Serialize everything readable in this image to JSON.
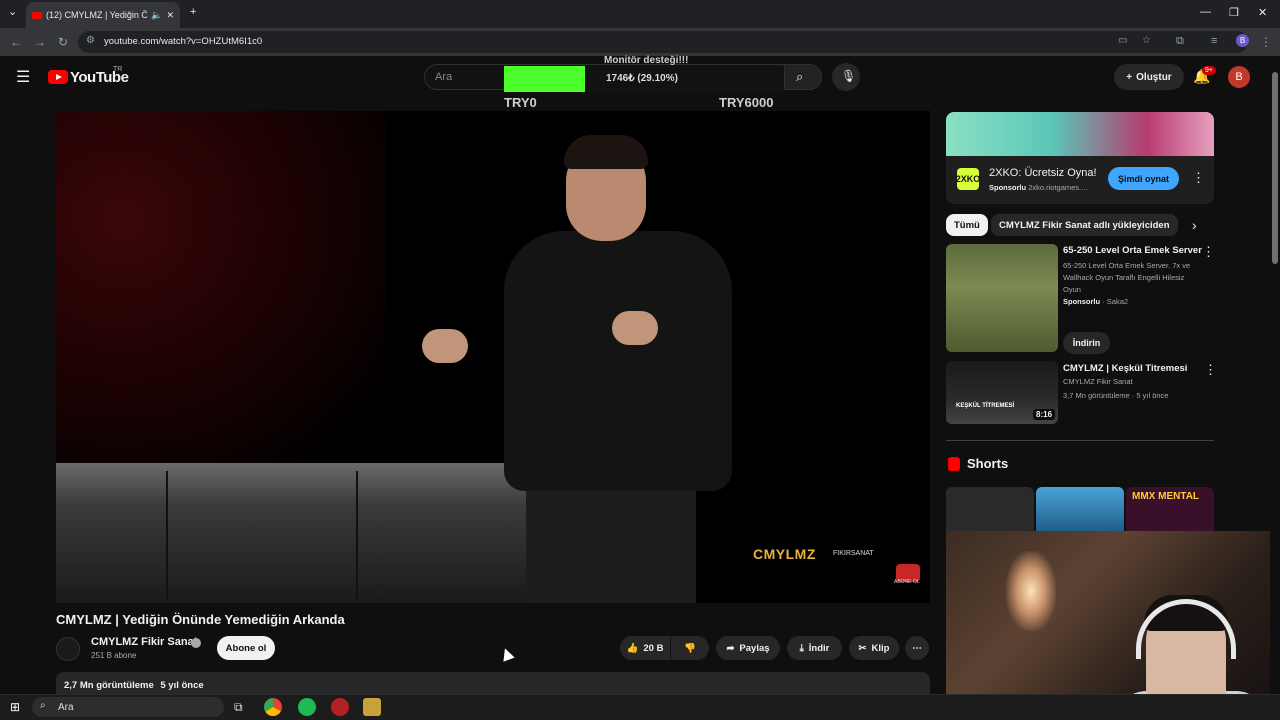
{
  "browser": {
    "tab_title": "(12) CMYLMZ | Yediğin Önü",
    "url": "youtube.com/watch?v=OHZUtM6I1c0"
  },
  "youtube": {
    "logo_text": "YouTube",
    "region": "TR",
    "search_placeholder": "Ara",
    "create_label": "Oluştur",
    "notification_count": "9+",
    "avatar_letter": "B"
  },
  "donation": {
    "title": "Monitör desteği!!!",
    "amount_text": "1746₺ (29.10%)",
    "progress_fraction": 0.291,
    "min_label": "TRY0",
    "max_label": "TRY6000"
  },
  "video": {
    "watermark": "CMYLMZ",
    "watermark_sub": "FIKIRSANAT",
    "subscribe_overlay": "ABONE OL",
    "title": "CMYLMZ | Yediğin Önünde Yemediğin Arkanda",
    "channel_name": "CMYLMZ Fikir Sanat",
    "subscribers": "251 B abone",
    "subscribe_label": "Abone ol",
    "like_count": "20 B",
    "share_label": "Paylaş",
    "download_label": "İndir",
    "clip_label": "Klip",
    "views": "2,7 Mn görüntüleme",
    "age": "5 yıl önce"
  },
  "sidebar": {
    "ad": {
      "logo": "2XKO",
      "title": "2XKO: Ücretsiz Oyna!",
      "sponsored": "Sponsorlu",
      "domain": "2xko.riotgames....",
      "cta": "Şimdi oynat"
    },
    "chips": [
      "Tümü",
      "CMYLMZ Fikir Sanat adlı yükleyiciden"
    ],
    "recs": [
      {
        "title": "65-250 Level Orta Emek Server",
        "desc": "65-250 Level Orta Emek Server. 7x ve Wallhack Oyun Taraflı Engelli Hilesiz Oyun",
        "sponsored": "Sponsorlu",
        "advertiser": "Saka2",
        "cta": "İndirin"
      },
      {
        "title": "CMYLMZ | Keşkül Titremesi",
        "channel": "CMYLMZ Fikir Sanat",
        "meta": "3,7 Mn görüntüleme · 5 yıl önce",
        "duration": "8:16",
        "thumb_caption": "KEŞKÜL TİTREMESİ"
      }
    ],
    "shorts_title": "Shorts",
    "shorts_thumb_text": "MMX MENTAL"
  },
  "taskbar": {
    "search_placeholder": "Ara"
  },
  "colors": {
    "youtube_red": "#ff0000",
    "progress_green": "#4cff2c",
    "cta_blue": "#3ea6ff"
  }
}
